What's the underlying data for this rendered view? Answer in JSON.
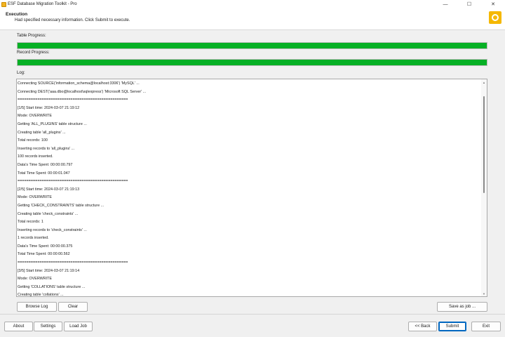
{
  "window": {
    "title": "ESF Database Migration Toolkit - Pro",
    "minimize_glyph": "—",
    "maximize_glyph": "☐",
    "close_glyph": "✕"
  },
  "header": {
    "title": "Execution",
    "subtitle": "Had specified necessary information. Click Submit to execute.",
    "logo_icon": "esf-logo-icon"
  },
  "progress": {
    "table_label": "Table Progress:",
    "table_value": 1.0,
    "record_label": "Record Progress:",
    "record_value": 1.0,
    "color": "#06b025"
  },
  "log": {
    "label": "Log:",
    "lines": [
      "Connecting SOURCE('information_schema@localhost:3306') 'MySQL' ...",
      "Connecting DEST('aaa.dbo@localhost\\sqlexpress') 'Microsoft SQL Server' ...",
      "==================================================",
      "[1/5] Start time: 2024-03-07 21:19:12",
      "Mode: OVERWRITE",
      "Getting 'ALL_PLUGINS' table structure ...",
      "Creating table 'all_plugins' ...",
      "Total records: 100",
      "Inserting records to 'all_plugins' ...",
      "100 records inserted.",
      "Data's Time Spent: 00:00:00.797",
      "Total Time Spent: 00:00:01.047",
      "==================================================",
      "[2/5] Start time: 2024-03-07 21:19:13",
      "Mode: OVERWRITE",
      "Getting 'CHECK_CONSTRAINTS' table structure ...",
      "Creating table 'check_constraints' ...",
      "Total records: 1",
      "Inserting records to 'check_constraints' ...",
      "1 records inserted.",
      "Data's Time Spent: 00:00:00.375",
      "Total Time Spent: 00:00:00.562",
      "==================================================",
      "[3/5] Start time: 2024-03-07 21:19:14",
      "Mode: OVERWRITE",
      "Getting 'COLLATIONS' table structure ...",
      "Creating table 'collations' ..."
    ],
    "scroll_up_glyph": "▲",
    "scroll_down_glyph": "▼"
  },
  "buttons": {
    "browse_log": "Browse Log",
    "clear": "Clear",
    "save_as_job": "Save as job ...",
    "about": "About",
    "settings": "Settings",
    "load_job": "Load Job",
    "back": "<< Back",
    "submit": "Submit",
    "exit": "Exit"
  }
}
